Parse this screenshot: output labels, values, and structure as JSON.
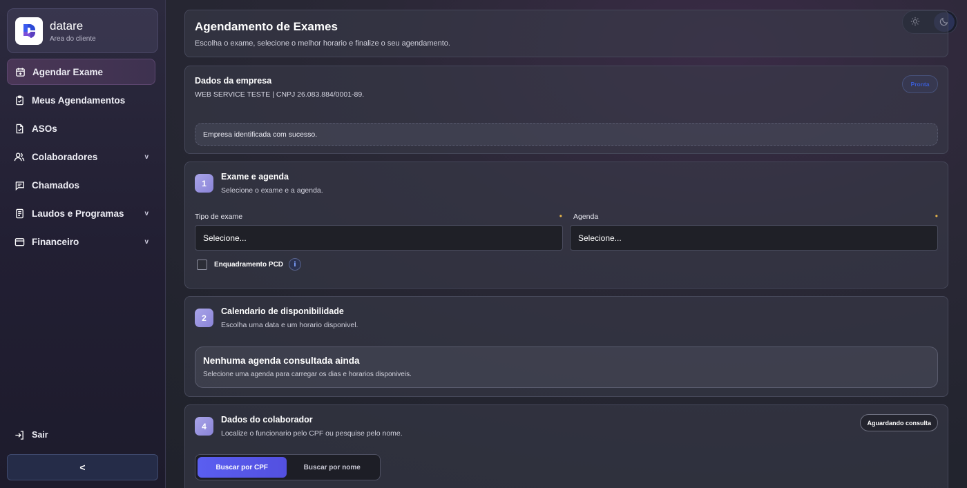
{
  "brand": {
    "name": "datare",
    "subtitle": "Area do cliente"
  },
  "sidebar": {
    "items": [
      {
        "label": "Agendar Exame",
        "icon": "calendar-plus-icon",
        "active": true,
        "has_submenu": false
      },
      {
        "label": "Meus Agendamentos",
        "icon": "clipboard-check-icon",
        "active": false,
        "has_submenu": false
      },
      {
        "label": "ASOs",
        "icon": "file-check-icon",
        "active": false,
        "has_submenu": false
      },
      {
        "label": "Colaboradores",
        "icon": "users-icon",
        "active": false,
        "has_submenu": true
      },
      {
        "label": "Chamados",
        "icon": "message-square-icon",
        "active": false,
        "has_submenu": false
      },
      {
        "label": "Laudos e Programas",
        "icon": "file-text-icon",
        "active": false,
        "has_submenu": true
      },
      {
        "label": "Financeiro",
        "icon": "wallet-icon",
        "active": false,
        "has_submenu": true
      }
    ],
    "chevron": "v",
    "logout_label": "Sair",
    "collapse_label": "<"
  },
  "theme": {
    "light_icon": "sun-icon",
    "dark_icon": "moon-icon",
    "selected": "dark"
  },
  "header": {
    "title": "Agendamento de Exames",
    "subtitle": "Escolha o exame, selecione o melhor horario e finalize o seu agendamento."
  },
  "company": {
    "title": "Dados da empresa",
    "info": "WEB SERVICE TESTE | CNPJ 26.083.884/0001-89.",
    "badge": "Pronta",
    "success_message": "Empresa identificada com sucesso."
  },
  "step1": {
    "number": "1",
    "title": "Exame e agenda",
    "subtitle": "Selecione o exame e a agenda.",
    "exam_type_label": "Tipo de exame",
    "exam_type_value": "Selecione...",
    "agenda_label": "Agenda",
    "agenda_value": "Selecione...",
    "pcd_label": "Enquadramento PCD",
    "pcd_checked": false,
    "info_glyph": "i"
  },
  "step2": {
    "number": "2",
    "title": "Calendario de disponibilidade",
    "subtitle": "Escolha uma data e um horario disponivel.",
    "empty_title": "Nenhuma agenda consultada ainda",
    "empty_subtitle": "Selecione uma agenda para carregar os dias e horarios disponiveis."
  },
  "step4": {
    "number": "4",
    "title": "Dados do colaborador",
    "subtitle": "Localize o funcionario pelo CPF ou pesquise pelo nome.",
    "status_badge": "Aguardando consulta",
    "search_cpf": "Buscar por CPF",
    "search_name": "Buscar por nome",
    "selected_search": "cpf"
  },
  "colors": {
    "accent": "#5a5ef0",
    "step_badge": "#a9a4e8",
    "required_dot": "#e8b64a",
    "active_nav": "#4a3656"
  }
}
